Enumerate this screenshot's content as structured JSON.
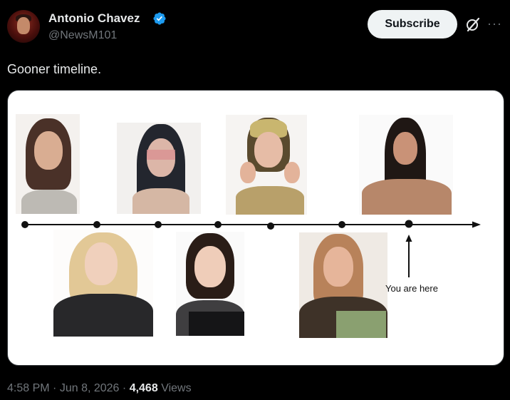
{
  "author": {
    "name": "Antonio Chavez",
    "handle": "@NewsM101",
    "verified": true
  },
  "actions": {
    "subscribe_label": "Subscribe"
  },
  "post": {
    "text": "Gooner timeline."
  },
  "media": {
    "annotation": "You are here"
  },
  "meta": {
    "time": "4:58 PM",
    "separator1": "·",
    "date": "Jun 8, 2026",
    "separator2": "·",
    "views_count": "4,468",
    "views_label": "Views"
  },
  "colors": {
    "background": "#000000",
    "text_primary": "#e7e9ea",
    "text_secondary": "#71767b",
    "verified_blue": "#1d9bf0",
    "button_bg": "#eff3f4"
  }
}
